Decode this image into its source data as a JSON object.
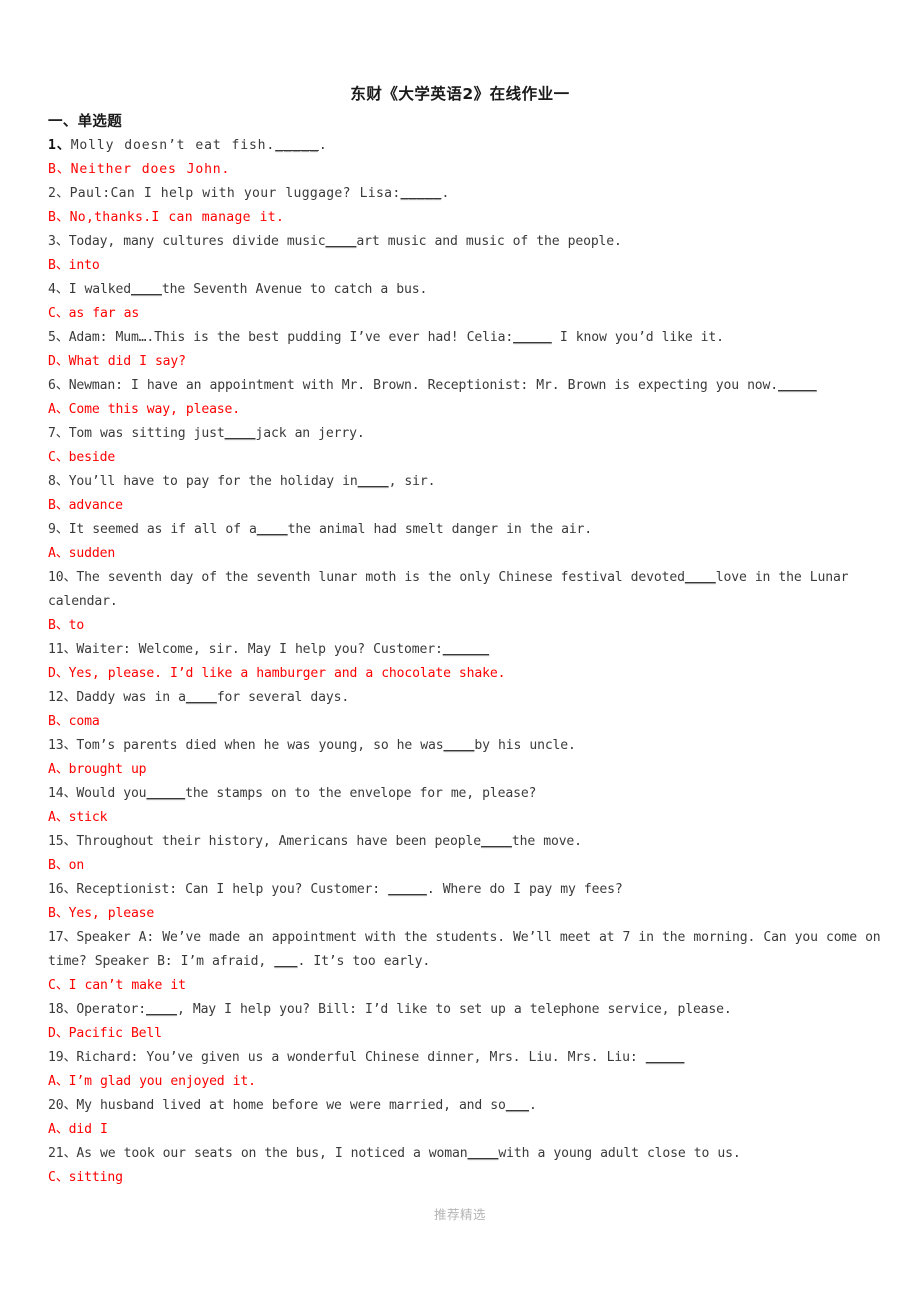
{
  "document": {
    "title": "东财《大学英语2》在线作业一",
    "footer_note": "推荐精选",
    "colors": {
      "answer_red": "#ff0000",
      "question_text": "#3a3a3a",
      "title_text": "#1a1a1a",
      "footer_text": "#b5b5b5",
      "page_background": "#ffffff"
    }
  },
  "sections": [
    {
      "heading": "一、单选题",
      "items": [
        {
          "number": "1、",
          "question": "Molly doesn’t eat fish.",
          "blank": "_____",
          "question_tail": ".",
          "answer": "B、Neither does John."
        },
        {
          "number": "2、",
          "question": "Paul:Can I help with your luggage? Lisa:",
          "blank": "_____",
          "question_tail": ".",
          "answer": "B、No,thanks.I can manage it."
        },
        {
          "number": "3、",
          "question": "Today, many cultures divide music",
          "blank": "____",
          "question_tail": "art music and music of the people.",
          "answer": "B、into"
        },
        {
          "number": "4、",
          "question": "I walked",
          "blank": "____",
          "question_tail": "the Seventh Avenue to catch a bus.",
          "answer": "C、as far as"
        },
        {
          "number": "5、",
          "question": "Adam: Mum….This is the best pudding I’ve ever had! Celia:",
          "blank": "_____",
          "question_tail": " I know you’d like it.",
          "answer": "D、What did I say?"
        },
        {
          "number": "6、",
          "question": "Newman: I have an appointment with Mr. Brown. Receptionist: Mr. Brown is expecting you now.",
          "blank": "_____",
          "question_tail": "",
          "answer": "A、Come this way, please."
        },
        {
          "number": "7、",
          "question": "Tom was sitting just",
          "blank": "____",
          "question_tail": "jack an jerry.",
          "answer": "C、beside"
        },
        {
          "number": "8、",
          "question": "You’ll have to pay for the holiday in",
          "blank": "____",
          "question_tail": ", sir.",
          "answer": "B、advance"
        },
        {
          "number": "9、",
          "question": "It seemed as if all of a",
          "blank": "____",
          "question_tail": "the animal had smelt danger in the air.",
          "answer": "A、sudden"
        },
        {
          "number": "10、",
          "question": "The seventh day of the seventh lunar moth is the only Chinese festival devoted",
          "blank": "____",
          "question_tail": "love in the Lunar calendar.",
          "answer": "B、to"
        },
        {
          "number": "11、",
          "question": "Waiter: Welcome, sir. May I help you? Customer:",
          "blank": "______",
          "question_tail": "",
          "answer": "D、Yes, please. I’d like a hamburger and a chocolate shake."
        },
        {
          "number": "12、",
          "question": "Daddy was in a",
          "blank": "____",
          "question_tail": "for several days.",
          "answer": "B、coma"
        },
        {
          "number": "13、",
          "question": "Tom’s parents died when he was young, so he was",
          "blank": "____",
          "question_tail": "by his uncle.",
          "answer": "A、brought up"
        },
        {
          "number": "14、",
          "question": "Would you",
          "blank": "_____",
          "question_tail": "the stamps on to the envelope for me, please?",
          "answer": "A、stick"
        },
        {
          "number": "15、",
          "question": "Throughout their history, Americans have been people",
          "blank": "____",
          "question_tail": "the move.",
          "answer": "B、on"
        },
        {
          "number": "16、",
          "question": "Receptionist: Can I help you? Customer: ",
          "blank": "_____",
          "question_tail": ". Where do I pay my fees?",
          "answer": "B、Yes, please"
        },
        {
          "number": "17、",
          "question": "Speaker A: We’ve made an appointment with the students. We’ll meet at 7 in the morning. Can you come on time? Speaker B: I’m afraid, ",
          "blank": "___",
          "question_tail": ". It’s too early.",
          "answer": "C、I can’t make it"
        },
        {
          "number": "18、",
          "question": "Operator:",
          "blank": "____",
          "question_tail": ", May I help you? Bill: I’d like to set up a telephone service, please.",
          "answer": "D、Pacific Bell"
        },
        {
          "number": "19、",
          "question": "Richard: You’ve given us a wonderful Chinese dinner, Mrs. Liu. Mrs. Liu: ",
          "blank": "_____",
          "question_tail": "",
          "answer": "A、I’m glad you enjoyed it."
        },
        {
          "number": "20、",
          "question": "My husband lived at home before we were married, and so",
          "blank": "___",
          "question_tail": ".",
          "answer": "A、did I"
        },
        {
          "number": "21、",
          "question": "As we took our seats on the bus, I noticed a woman",
          "blank": "____",
          "question_tail": "with a young adult close to us.",
          "answer": "C、sitting"
        }
      ]
    }
  ]
}
